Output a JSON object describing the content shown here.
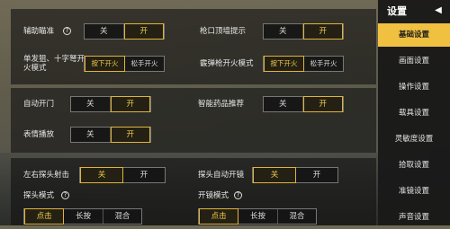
{
  "sidebar": {
    "title": "设置",
    "items": [
      {
        "label": "基础设置",
        "active": true
      },
      {
        "label": "画面设置"
      },
      {
        "label": "操作设置"
      },
      {
        "label": "载具设置"
      },
      {
        "label": "灵敏度设置"
      },
      {
        "label": "拾取设置"
      },
      {
        "label": "准镜设置"
      },
      {
        "label": "声音设置"
      }
    ]
  },
  "settings": {
    "aim_assist": {
      "label": "辅助瞄准",
      "off": "关",
      "on": "开"
    },
    "muzzle_wall_hint": {
      "label": "枪口顶墙提示",
      "off": "关",
      "on": "开"
    },
    "single_crossbow_fire": {
      "label": "单发狙、十字弩开火模式",
      "press": "按下开火",
      "release": "松手开火"
    },
    "shotgun_fire": {
      "label": "霰弹枪开火模式",
      "press": "按下开火",
      "release": "松手开火"
    },
    "auto_door": {
      "label": "自动开门",
      "off": "关",
      "on": "开"
    },
    "smart_medicine": {
      "label": "智能药品推荐",
      "off": "关",
      "on": "开"
    },
    "emote_play": {
      "label": "表情播放",
      "off": "关",
      "on": "开"
    },
    "lean_fire": {
      "label": "左右探头射击",
      "off": "关",
      "on": "开"
    },
    "lean_auto_scope": {
      "label": "探头自动开镜",
      "off": "关",
      "on": "开"
    },
    "lean_mode": {
      "label": "探头模式",
      "opt1": "点击",
      "opt2": "长按",
      "opt3": "混合"
    },
    "scope_mode": {
      "label": "开镜模式",
      "opt1": "点击",
      "opt2": "长按",
      "opt3": "混合"
    }
  },
  "colors": {
    "accent": "#f0c040",
    "panel": "#121212"
  }
}
